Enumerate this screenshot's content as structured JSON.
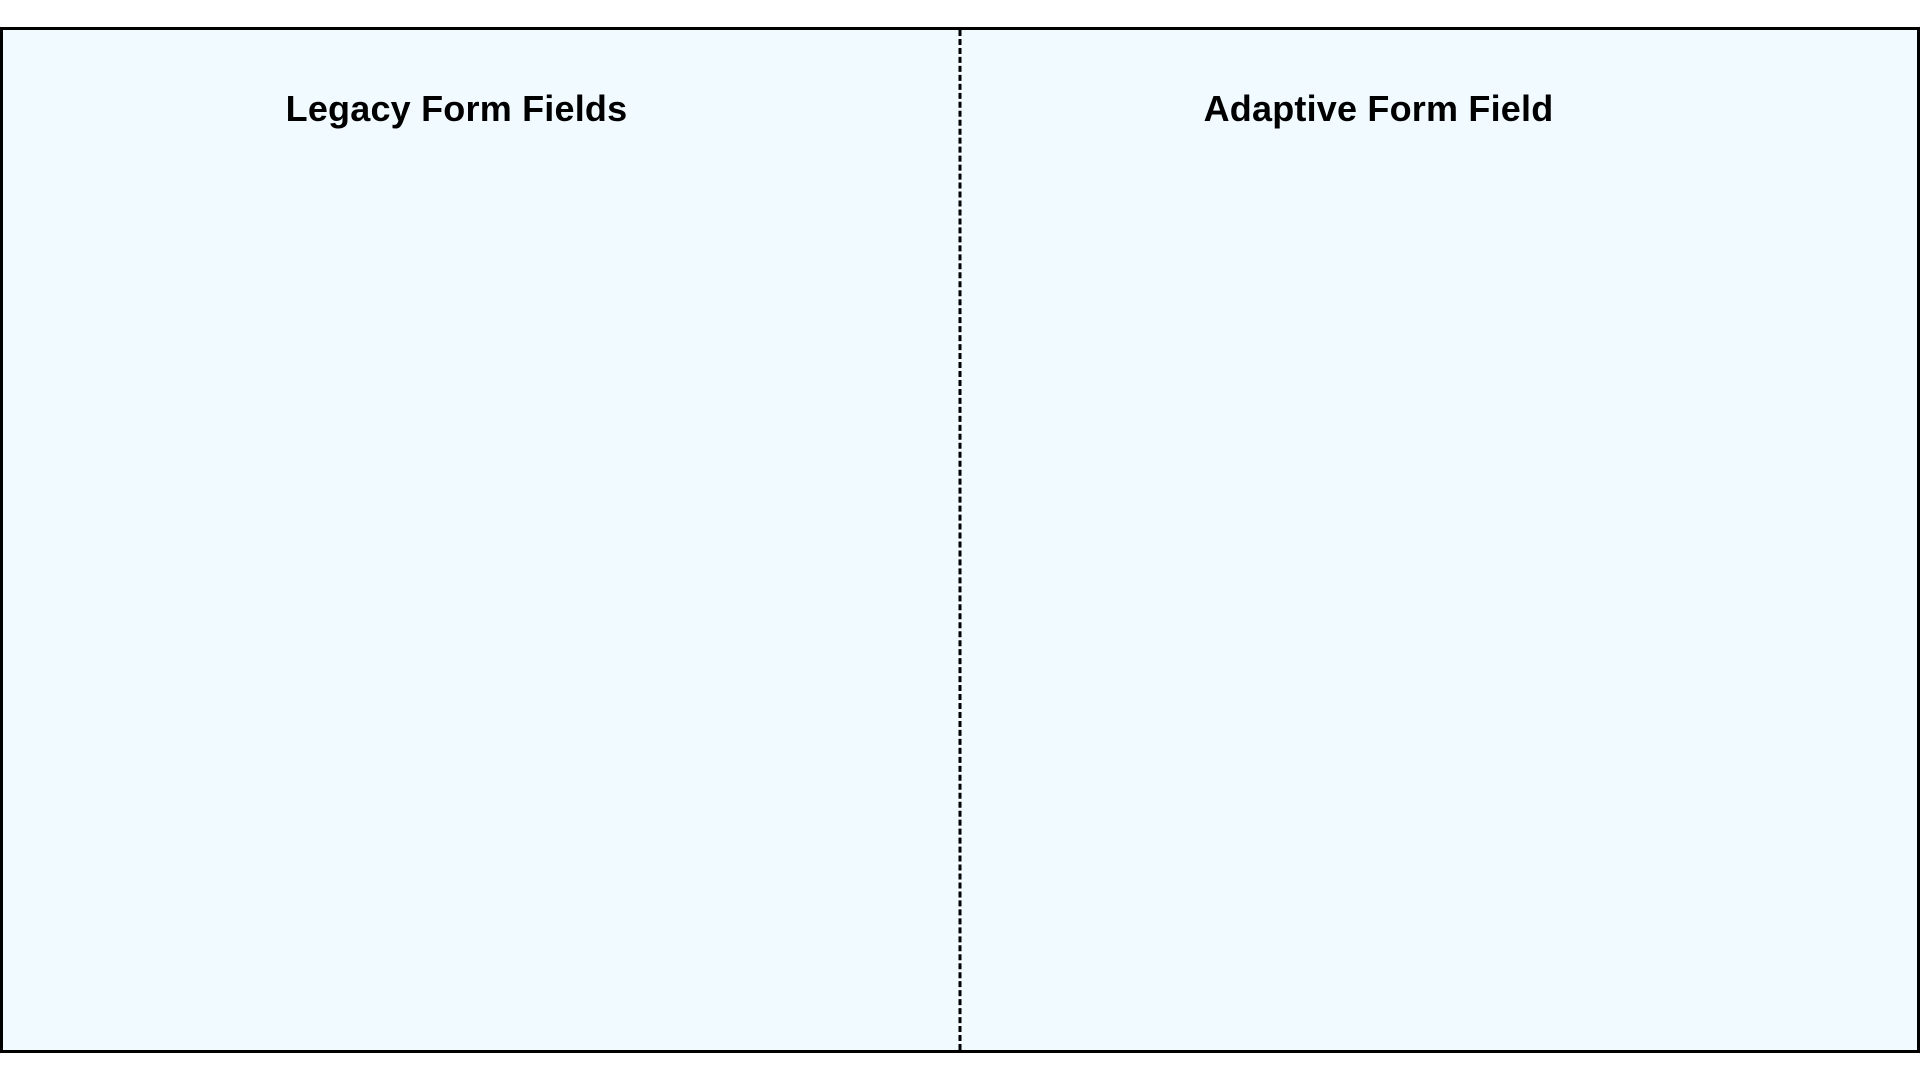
{
  "panels": {
    "left": {
      "title": "Legacy Form Fields"
    },
    "right": {
      "title": "Adaptive Form Field"
    }
  }
}
